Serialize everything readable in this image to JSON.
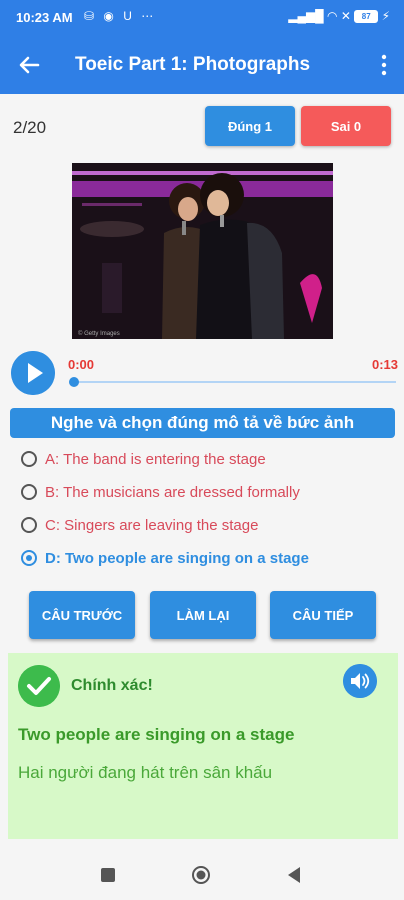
{
  "status_bar": {
    "time": "10:23 AM",
    "notification_icons": "⛁ ◉ U ⋯",
    "right_icons": "▂▄▆█ ◠ ✕",
    "battery": "87"
  },
  "app_bar": {
    "title": "Toeic Part 1: Photographs",
    "back_icon": "arrow-left-icon",
    "more_icon": "more-vert-icon",
    "color": "#2f7fe6"
  },
  "progress": {
    "counter": "2/20",
    "correct_label": "Đúng 1",
    "wrong_label": "Sai 0"
  },
  "player": {
    "current_time": "0:00",
    "duration": "0:13",
    "progress": 0.0
  },
  "question": {
    "prompt": "Nghe và chọn đúng mô tả về bức ảnh",
    "options": [
      {
        "label": "A: The band is entering the stage",
        "selected": false
      },
      {
        "label": "B: The musicians are dressed formally",
        "selected": false
      },
      {
        "label": "C: Singers are leaving the stage",
        "selected": false
      },
      {
        "label": "D: Two people are singing on a stage",
        "selected": true
      }
    ]
  },
  "actions": {
    "prev": "CÂU TRƯỚC",
    "retry": "LÀM LẠI",
    "next": "CÂU TIẾP"
  },
  "result": {
    "status": "Chính xác!",
    "answer_en": "Two people are singing on a stage",
    "answer_vi": "Hai người đang hát trên sân khấu"
  },
  "colors": {
    "accent": "#2f8ee0",
    "wrong": "#f55a5a",
    "result_bg": "#d7f9c8",
    "success": "#3dbb4c"
  }
}
